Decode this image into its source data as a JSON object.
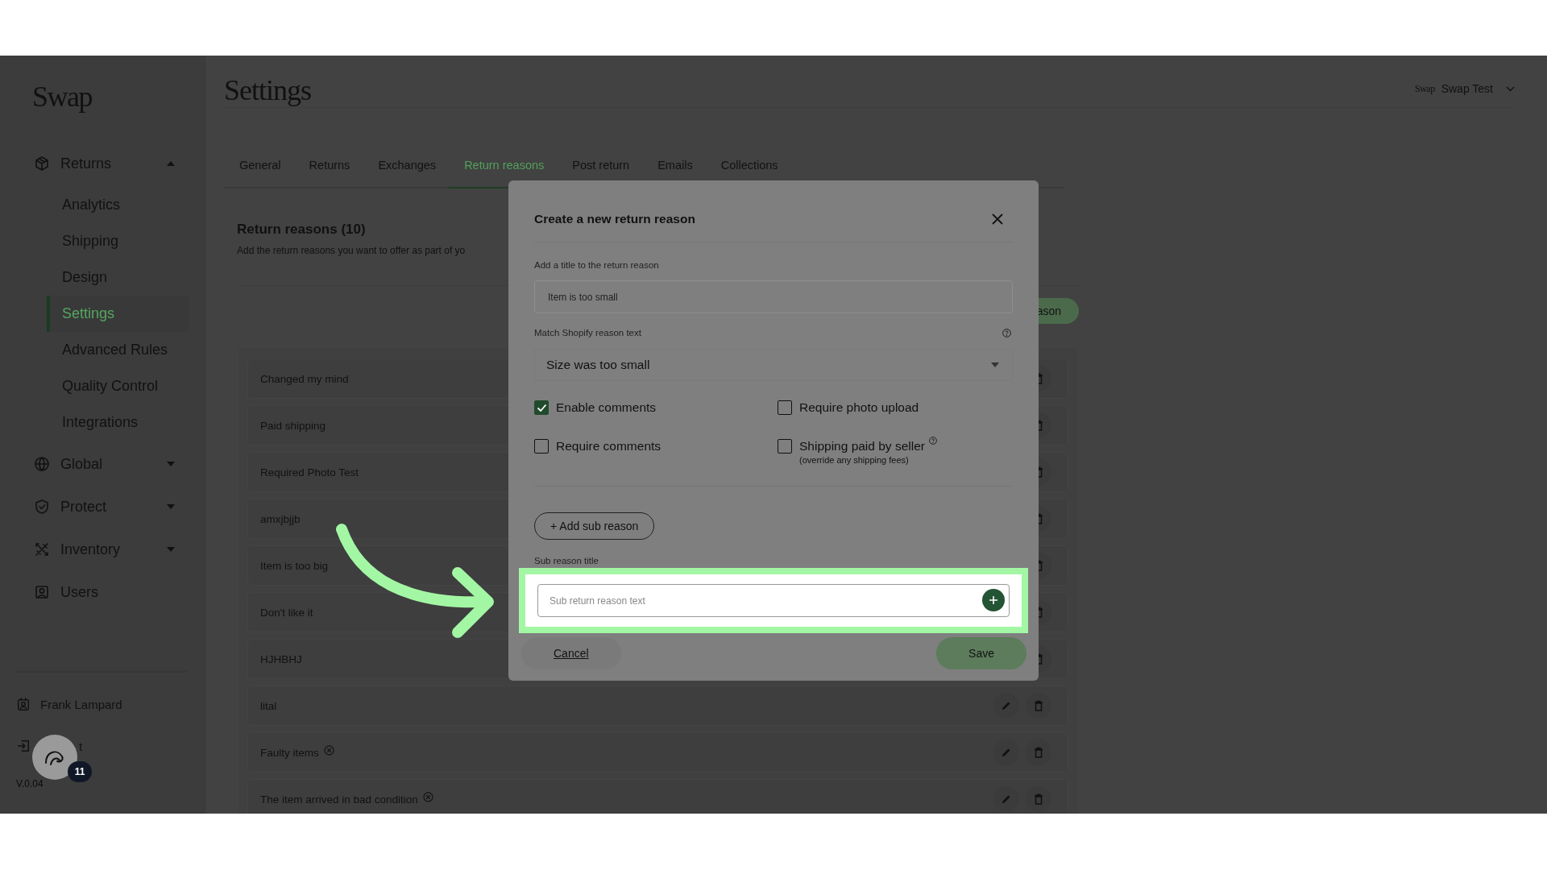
{
  "brand": {
    "logo": "Swap"
  },
  "sidebar": {
    "items": [
      {
        "label": "Returns",
        "kind": "menu",
        "expanded": true,
        "children": [
          {
            "label": "Analytics",
            "selected": false
          },
          {
            "label": "Shipping",
            "selected": false
          },
          {
            "label": "Design",
            "selected": false
          },
          {
            "label": "Settings",
            "selected": true
          },
          {
            "label": "Advanced Rules",
            "selected": false
          },
          {
            "label": "Quality Control",
            "selected": false
          },
          {
            "label": "Integrations",
            "selected": false
          }
        ]
      },
      {
        "label": "Global",
        "kind": "menu",
        "expanded": false
      },
      {
        "label": "Protect",
        "kind": "menu",
        "expanded": false
      },
      {
        "label": "Inventory",
        "kind": "menu",
        "expanded": false
      },
      {
        "label": "Users",
        "kind": "link"
      }
    ]
  },
  "account": {
    "user": "Frank Lampard",
    "logout_label": "t",
    "version": "V.0.04"
  },
  "help_widget": {
    "badge": "11"
  },
  "header": {
    "title": "Settings",
    "store_logo": "Swap",
    "store_name": "Swap Test"
  },
  "tabs": [
    {
      "label": "General",
      "selected": false
    },
    {
      "label": "Returns",
      "selected": false
    },
    {
      "label": "Exchanges",
      "selected": false
    },
    {
      "label": "Return reasons",
      "selected": true
    },
    {
      "label": "Post return",
      "selected": false
    },
    {
      "label": "Emails",
      "selected": false
    },
    {
      "label": "Collections",
      "selected": false
    }
  ],
  "section": {
    "title": "Return reasons (10)",
    "description": "Add the return reasons you want to offer as part of yo",
    "add_button": "ason"
  },
  "reasons": [
    {
      "label": "Changed my mind",
      "flagged": false,
      "kind": "covered"
    },
    {
      "label": "Paid shipping",
      "flagged": false,
      "kind": "covered"
    },
    {
      "label": "Required Photo Test",
      "flagged": false,
      "kind": "covered"
    },
    {
      "label": "amxjbjjb",
      "flagged": false,
      "kind": "covered"
    },
    {
      "label": "Item is too big",
      "flagged": false,
      "kind": "covered"
    },
    {
      "label": "Don't like it",
      "flagged": false,
      "kind": "covered"
    },
    {
      "label": "HJHBHJ",
      "flagged": false,
      "kind": "covered"
    },
    {
      "label": "lital",
      "flagged": false,
      "kind": "open"
    },
    {
      "label": "Faulty items",
      "flagged": true,
      "kind": "open"
    },
    {
      "label": "The item arrived in bad condition",
      "flagged": true,
      "kind": "open"
    }
  ],
  "modal": {
    "title": "Create a new return reason",
    "title_label": "Add a title to the return reason",
    "title_value": "Item is too small",
    "shopify_label": "Match Shopify reason text",
    "shopify_value": "Size was too small",
    "options": [
      {
        "label": "Enable comments",
        "checked": true
      },
      {
        "label": "Require photo upload",
        "checked": false
      },
      {
        "label": "Require comments",
        "checked": false
      },
      {
        "label": "Shipping paid by seller",
        "checked": false,
        "help": true,
        "note": "(override any shipping fees)"
      }
    ],
    "add_sub_button": "+ Add sub reason",
    "sub_title_label": "Sub reason title",
    "sub_placeholder": "Sub return reason text",
    "cancel": "Cancel",
    "save": "Save"
  }
}
